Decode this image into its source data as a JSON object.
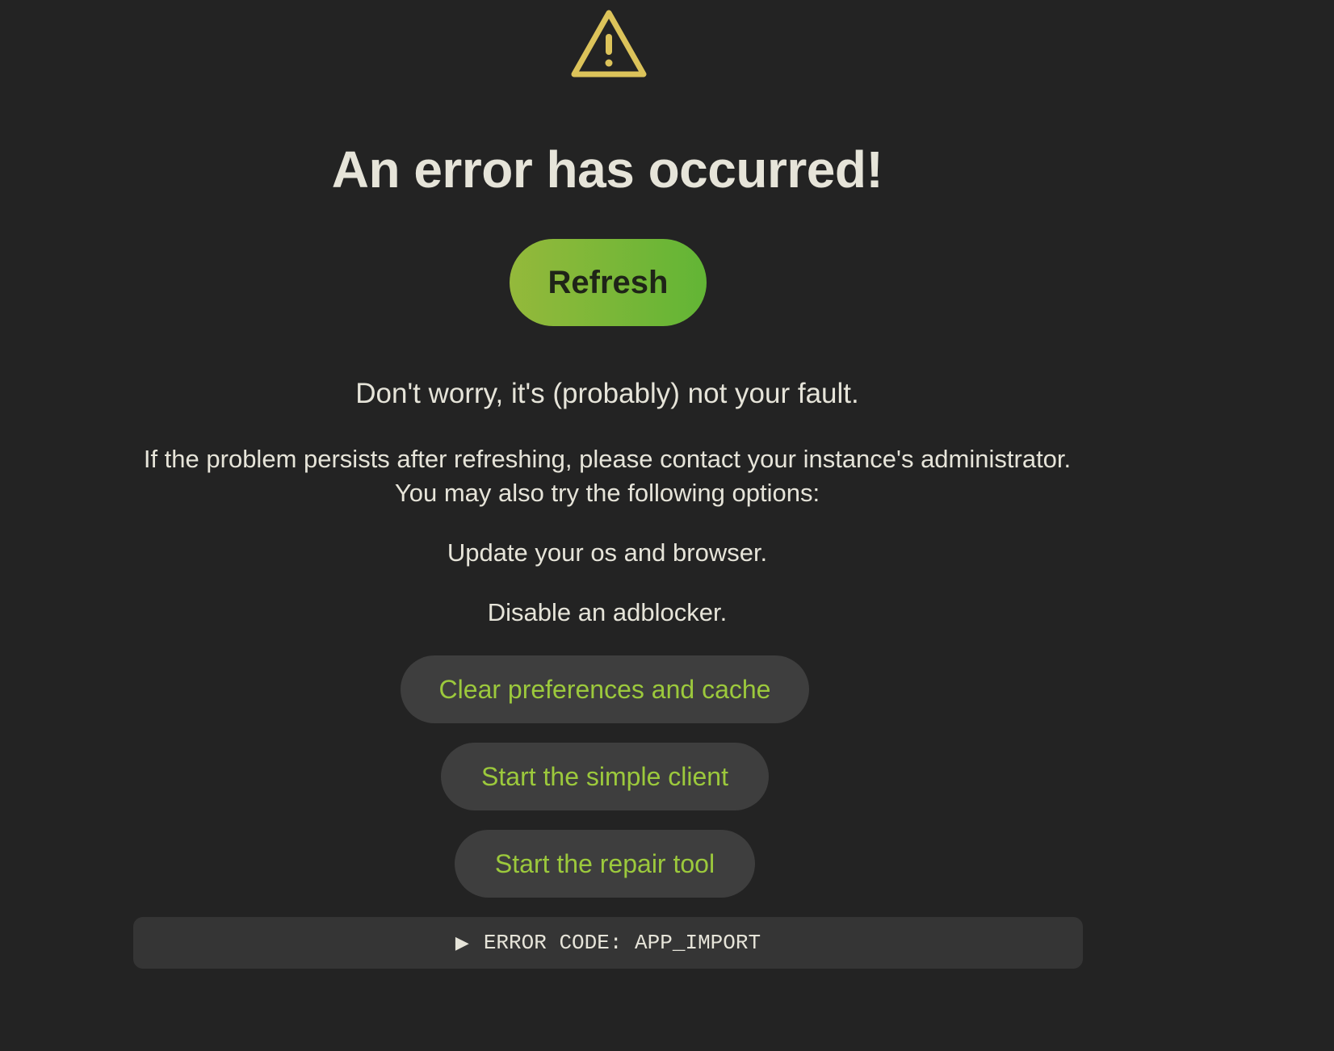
{
  "error_page": {
    "icon": "warning-triangle-icon",
    "title": "An error has occurred!",
    "refresh_label": "Refresh",
    "reassurance": "Don't worry, it's (probably) not your fault.",
    "persist_message": "If the problem persists after refreshing, please contact your instance's administrator.",
    "options_intro": "You may also try the following options:",
    "option_update": "Update your os and browser.",
    "option_adblock": "Disable an adblocker.",
    "actions": {
      "clear_cache": "Clear preferences and cache",
      "simple_client": "Start the simple client",
      "repair_tool": "Start the repair tool"
    },
    "error_code": "ERROR CODE: APP_IMPORT",
    "expand_icon": "caret-right-icon"
  },
  "colors": {
    "background": "#232323",
    "warning_yellow": "#dcc35a",
    "accent_green": "#9cc93c",
    "refresh_gradient_start": "#94b93b",
    "refresh_gradient_end": "#62b535",
    "pill_background": "#3e3e3e",
    "text": "#e6e4d9"
  }
}
